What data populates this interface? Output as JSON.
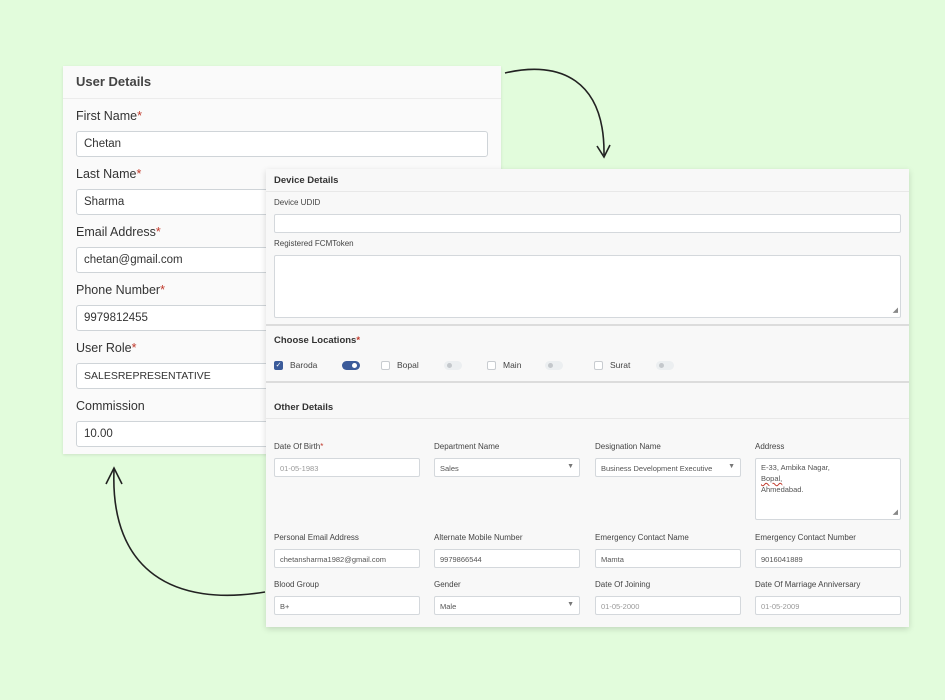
{
  "user_details": {
    "title": "User Details",
    "fields": [
      {
        "label": "First Name",
        "required": "*",
        "value": "Chetan"
      },
      {
        "label": "Last Name",
        "required": "*",
        "value": "Sharma"
      },
      {
        "label": "Email Address",
        "required": "*",
        "value": "chetan@gmail.com"
      },
      {
        "label": "Phone Number",
        "required": "*",
        "value": "9979812455"
      },
      {
        "label": "User Role",
        "required": "*",
        "value": "SALESREPRESENTATIVE"
      },
      {
        "label": "Commission",
        "required": "",
        "value": "10.00"
      }
    ]
  },
  "device_details": {
    "title": "Device Details",
    "udid_label": "Device UDID",
    "udid_value": "",
    "fcm_label": "Registered FCMToken",
    "fcm_value": ""
  },
  "locations": {
    "title": "Choose Locations",
    "required": "*",
    "items": [
      {
        "name": "Baroda",
        "checked": true,
        "toggle": true
      },
      {
        "name": "Bopal",
        "checked": false,
        "toggle": false
      },
      {
        "name": "Main",
        "checked": false,
        "toggle": false
      },
      {
        "name": "Surat",
        "checked": false,
        "toggle": false
      }
    ]
  },
  "other_details": {
    "title": "Other Details",
    "dob_label": "Date Of Birth",
    "dob_required": "*",
    "dob_value": "01-05-1983",
    "department_label": "Department Name",
    "department_value": "Sales",
    "designation_label": "Designation Name",
    "designation_value": "Business Development Executive",
    "address_label": "Address",
    "address_line1": "E-33, Ambika Nagar,",
    "address_line2": "Bopal,",
    "address_line3": "Ahmedabad.",
    "personal_email_label": "Personal Email Address",
    "personal_email_value": "chetansharma1982@gmail.com",
    "alt_mobile_label": "Alternate Mobile Number",
    "alt_mobile_value": "9979866544",
    "emergency_name_label": "Emergency Contact Name",
    "emergency_name_value": "Mamta",
    "emergency_number_label": "Emergency Contact Number",
    "emergency_number_value": "9016041889",
    "blood_group_label": "Blood Group",
    "blood_group_value": "B+",
    "gender_label": "Gender",
    "gender_value": "Male",
    "joining_label": "Date Of Joining",
    "joining_value": "01-05-2000",
    "anniversary_label": "Date Of Marriage Anniversary",
    "anniversary_value": "01-05-2009"
  },
  "icons": {
    "dropdown": "chevron-down-icon",
    "resize": "resize-handle-icon",
    "check": "check-icon"
  },
  "colors": {
    "background": "#e2fcdc",
    "accent": "#3b5b9a",
    "required": "#c0392b"
  }
}
